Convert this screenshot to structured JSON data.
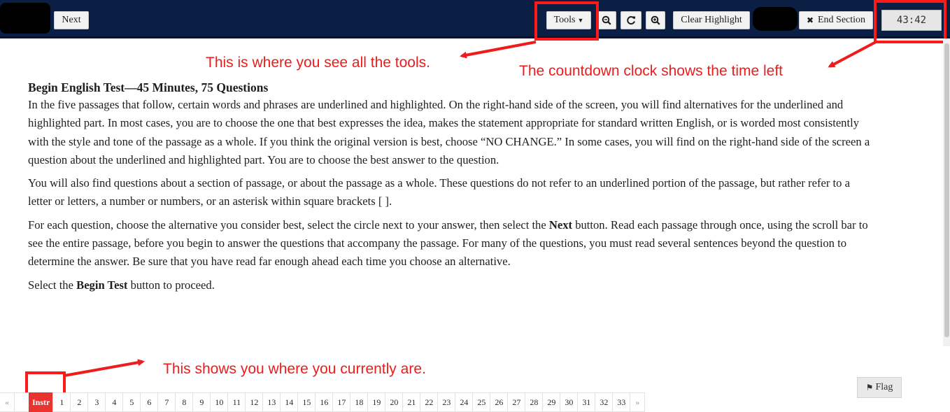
{
  "toolbar": {
    "next_label": "Next",
    "tools_label": "Tools",
    "zoom_out_icon": "zoom-out-icon",
    "reset_icon": "rotate-icon",
    "zoom_in_icon": "zoom-in-icon",
    "clear_highlight_label": "Clear Highlight",
    "end_section_label": "End Section",
    "end_section_icon": "close-icon",
    "timer": "43:42"
  },
  "annotations": {
    "tools_note": "This is where you see all the tools.",
    "clock_note": "The countdown clock shows the time left",
    "position_note": "This shows you where you currently are.",
    "color": "#ee1c1c"
  },
  "instructions": {
    "heading": "Begin English Test—45 Minutes, 75 Questions",
    "p1": "In the five passages that follow, certain words and phrases are underlined and highlighted. On the right-hand side of the screen, you will find alternatives for the underlined and highlighted part. In most cases, you are to choose the one that best expresses the idea, makes the statement appropriate for standard written English, or is worded most consistently with the style and tone of the passage as a whole. If you think the original version is best, choose “NO CHANGE.” In some cases, you will find on the right-hand side of the screen a question about the underlined and highlighted part. You are to choose the best answer to the question.",
    "p2": "You will also find questions about a section of passage, or about the passage as a whole. These questions do not refer to an underlined portion of the passage, but rather refer to a letter or letters, a number or numbers, or an asterisk within square brackets [ ].",
    "p3_a": "For each question, choose the alternative you consider best, select the circle next to your answer, then select the ",
    "p3_bold": "Next",
    "p3_b": " button. Read each passage through once, using the scroll bar to see the entire passage, before you begin to answer the questions that accompany the passage. For many of the questions, you must read several sentences beyond the question to determine the answer. Be sure that you have read far enough ahead each time you choose an alternative.",
    "p4_a": "Select the ",
    "p4_bold": "Begin Test",
    "p4_b": " button to proceed."
  },
  "flag_label": "Flag",
  "pager": {
    "prev": "«",
    "current": "Instr",
    "pages": [
      "1",
      "2",
      "3",
      "4",
      "5",
      "6",
      "7",
      "8",
      "9",
      "10",
      "11",
      "12",
      "13",
      "14",
      "15",
      "16",
      "17",
      "18",
      "19",
      "20",
      "21",
      "22",
      "23",
      "24",
      "25",
      "26",
      "27",
      "28",
      "29",
      "30",
      "31",
      "32",
      "33"
    ],
    "next": "»"
  },
  "colors": {
    "toolbar_bg": "#0b1f45",
    "highlight_box": "#ff1a1a",
    "active_page": "#e8332f"
  }
}
